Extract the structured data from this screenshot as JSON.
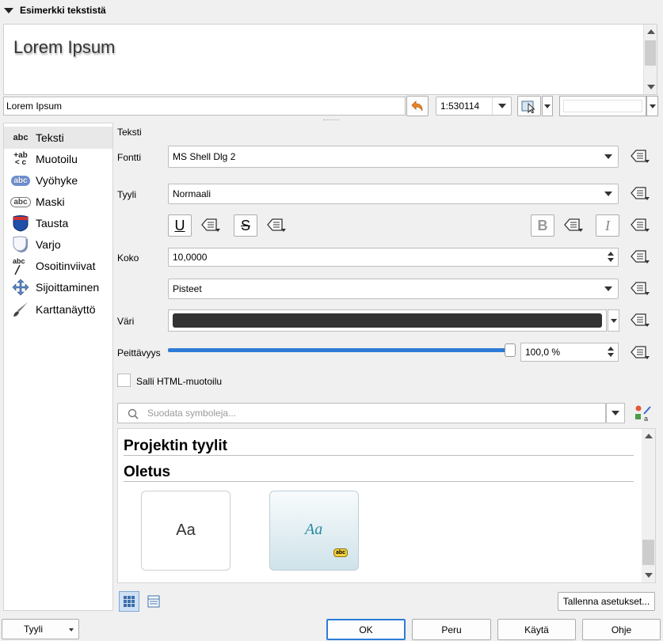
{
  "preview": {
    "header_label": "Esimerkki tekstistä",
    "sample_text": "Lorem Ipsum",
    "input_value": "Lorem Ipsum",
    "scale_value": "1:530114"
  },
  "sidebar": {
    "items": [
      {
        "label": "Teksti",
        "icon": "abc-text-icon"
      },
      {
        "label": "Muotoilu",
        "icon": "formatting-icon"
      },
      {
        "label": "Vyöhyke",
        "icon": "buffer-icon"
      },
      {
        "label": "Maski",
        "icon": "mask-icon"
      },
      {
        "label": "Tausta",
        "icon": "background-icon"
      },
      {
        "label": "Varjo",
        "icon": "shadow-icon"
      },
      {
        "label": "Osoitinviivat",
        "icon": "callouts-icon"
      },
      {
        "label": "Sijoittaminen",
        "icon": "placement-icon"
      },
      {
        "label": "Karttanäyttö",
        "icon": "rendering-icon"
      }
    ]
  },
  "text_panel": {
    "section_title": "Teksti",
    "font_label": "Fontti",
    "font_value": "MS Shell Dlg 2",
    "style_label": "Tyyli",
    "style_value": "Normaali",
    "underline_glyph": "U",
    "strike_glyph": "S",
    "bold_glyph": "B",
    "italic_glyph": "I",
    "size_label": "Koko",
    "size_value": "10,0000",
    "unit_value": "Pisteet",
    "color_label": "Väri",
    "color_value": "#333333",
    "opacity_label": "Peittävyys",
    "opacity_value": "100,0 %",
    "opacity_fraction": 1.0,
    "html_checkbox_label": "Salli HTML-muotoilu",
    "html_checked": false
  },
  "symbols": {
    "search_placeholder": "Suodata symboleja...",
    "group_project": "Projektin tyylit",
    "group_default": "Oletus",
    "swatches": [
      {
        "text": "Aa"
      },
      {
        "text": "Aa",
        "badge": "abc"
      }
    ],
    "save_button": "Tallenna asetukset..."
  },
  "footer": {
    "style_button": "Tyyli",
    "ok": "OK",
    "cancel": "Peru",
    "apply": "Käytä",
    "help": "Ohje"
  }
}
